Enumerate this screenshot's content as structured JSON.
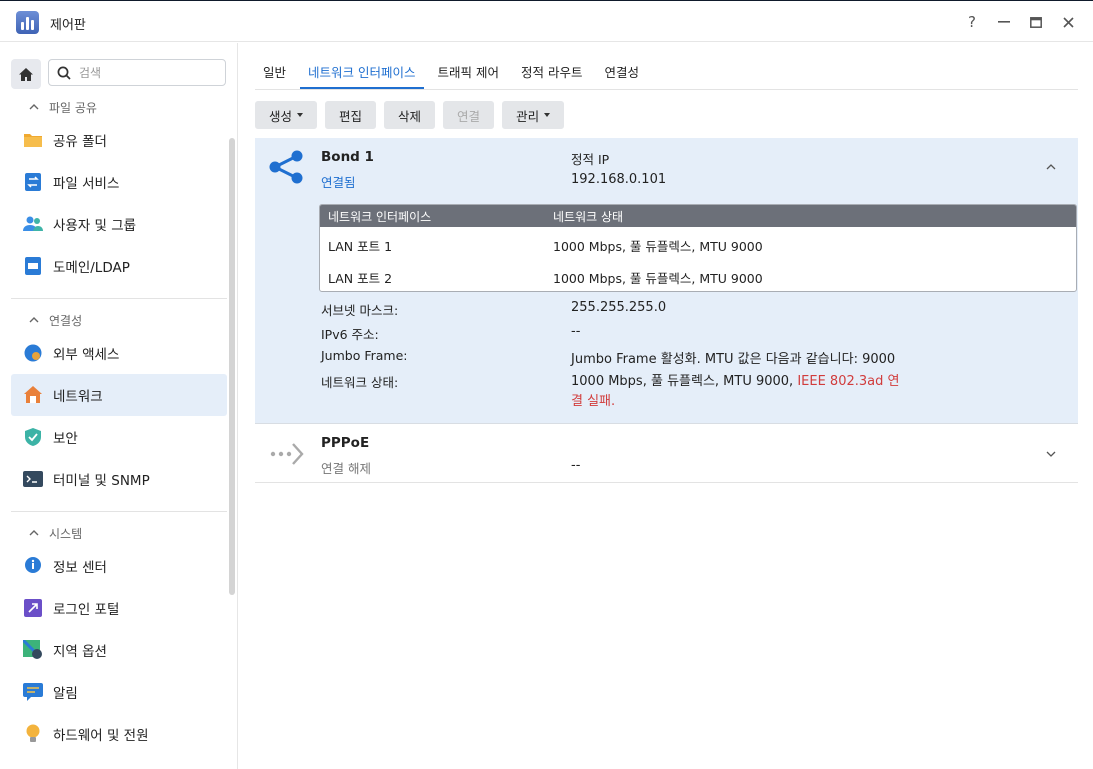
{
  "window": {
    "title": "제어판",
    "buttons": [
      "?",
      "—",
      "□",
      "✕"
    ]
  },
  "sidebar": {
    "search_placeholder": "검색",
    "sections": [
      {
        "label": "파일 공유",
        "items": [
          {
            "label": "공유 폴더",
            "icon": "folder-icon"
          },
          {
            "label": "파일 서비스",
            "icon": "file-services-icon"
          },
          {
            "label": "사용자 및 그룹",
            "icon": "users-icon"
          },
          {
            "label": "도메인/LDAP",
            "icon": "domain-icon"
          }
        ]
      },
      {
        "label": "연결성",
        "items": [
          {
            "label": "외부 액세스",
            "icon": "globe-icon"
          },
          {
            "label": "네트워크",
            "icon": "network-home-icon",
            "active": true
          },
          {
            "label": "보안",
            "icon": "shield-icon"
          },
          {
            "label": "터미널 및 SNMP",
            "icon": "terminal-icon"
          }
        ]
      },
      {
        "label": "시스템",
        "items": [
          {
            "label": "정보 센터",
            "icon": "info-icon"
          },
          {
            "label": "로그인 포털",
            "icon": "portal-icon"
          },
          {
            "label": "지역 옵션",
            "icon": "map-icon"
          },
          {
            "label": "알림",
            "icon": "chat-icon"
          },
          {
            "label": "하드웨어 및 전원",
            "icon": "bulb-icon"
          }
        ]
      }
    ]
  },
  "tabs": [
    "일반",
    "네트워크 인터페이스",
    "트래픽 제어",
    "정적 라우트",
    "연결성"
  ],
  "active_tab": 1,
  "toolbar": {
    "create": "생성",
    "edit": "편집",
    "delete": "삭제",
    "connect": "연결",
    "manage": "관리"
  },
  "interfaces": [
    {
      "name": "Bond 1",
      "status": "연결됨",
      "ip_mode": "정적 IP",
      "ip": "192.168.0.101",
      "table": {
        "headers": [
          "네트워크 인터페이스",
          "네트워크 상태"
        ],
        "rows": [
          [
            "LAN 포트 1",
            "1000 Mbps, 풀 듀플렉스, MTU 9000"
          ],
          [
            "LAN 포트 2",
            "1000 Mbps, 풀 듀플렉스, MTU 9000"
          ]
        ]
      },
      "details": [
        {
          "label": "서브넷 마스크:",
          "value": "255.255.255.0"
        },
        {
          "label": "IPv6 주소:",
          "value": "--"
        },
        {
          "label": "Jumbo Frame:",
          "value": "Jumbo Frame 활성화. MTU 값은 다음과 같습니다: 9000"
        },
        {
          "label": "네트워크 상태:",
          "value": "1000 Mbps, 풀 듀플렉스, MTU 9000, ",
          "error_line1": "IEEE 802.3ad 연",
          "error_line2": "결 실패."
        }
      ]
    },
    {
      "name": "PPPoE",
      "status": "연결 해제",
      "ip": "--"
    }
  ],
  "colors": {
    "accent": "#1f6fd0",
    "selected_bg": "#e5eef9",
    "error": "#d13c3c"
  }
}
